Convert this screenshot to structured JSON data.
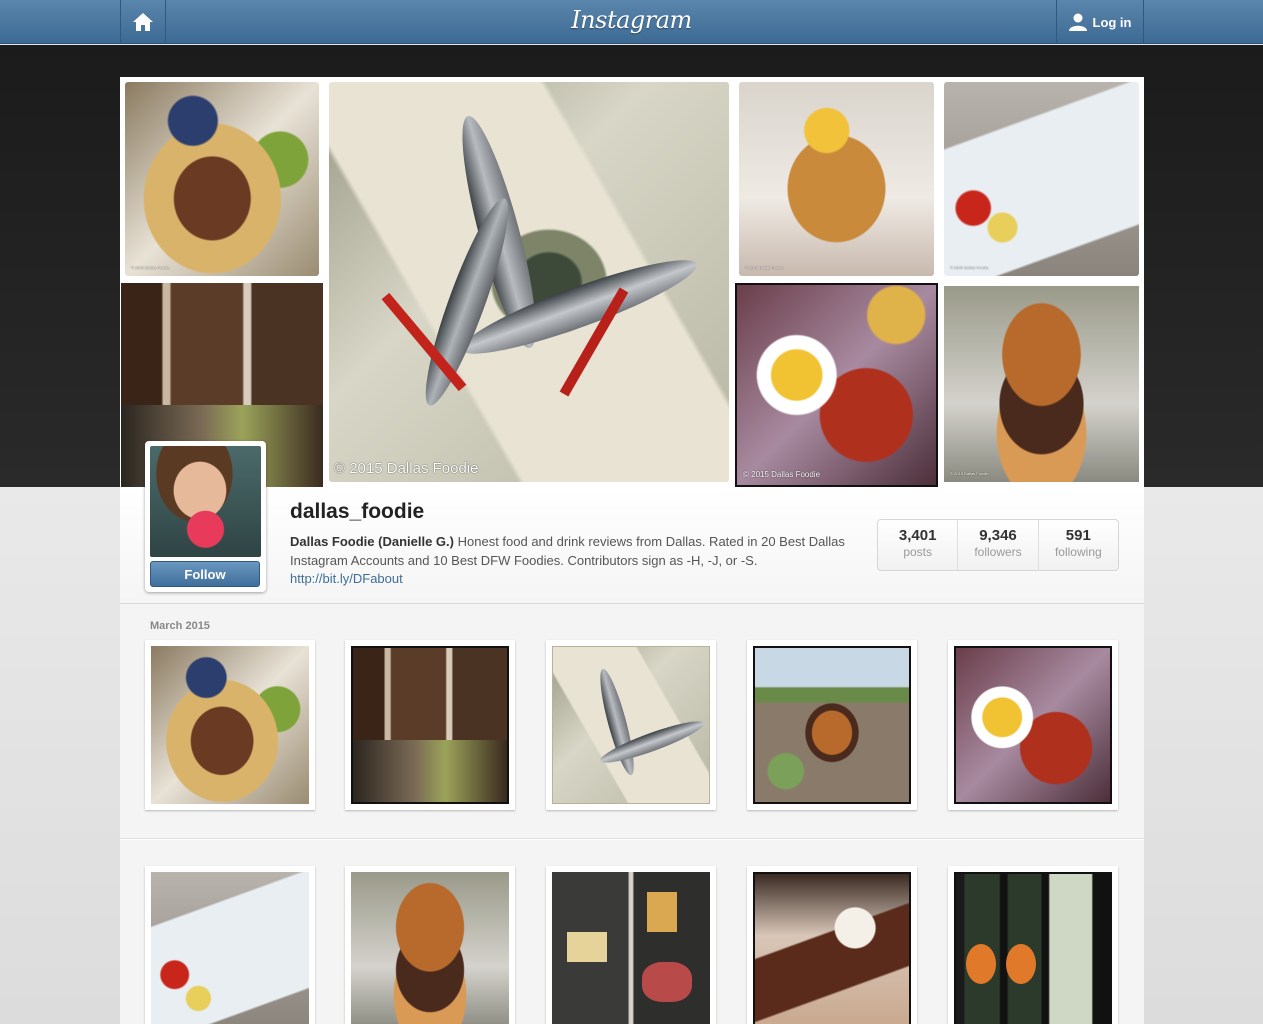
{
  "header": {
    "logo": "Instagram",
    "login_label": "Log in"
  },
  "mosaic": {
    "watermark": "© 2015 Dallas Foodie",
    "small_watermark": "© 2015 Dallas Foodie"
  },
  "profile": {
    "username": "dallas_foodie",
    "full_name": "Dallas Foodie (Danielle G.)",
    "bio": "Honest food and drink reviews from Dallas. Rated in 20 Best Dallas Instagram Accounts and 10 Best DFW Foodies. Contributors sign as -H, -J, or -S.",
    "link": "http://bit.ly/DFabout",
    "follow_label": "Follow",
    "stats": [
      {
        "value": "3,401",
        "label": "posts"
      },
      {
        "value": "9,346",
        "label": "followers"
      },
      {
        "value": "591",
        "label": "following"
      }
    ]
  },
  "feed": {
    "month": "March 2015"
  },
  "colors": {
    "topbar": "#4a79a3",
    "follow_button": "#5080ad",
    "link": "#3e6e99"
  }
}
